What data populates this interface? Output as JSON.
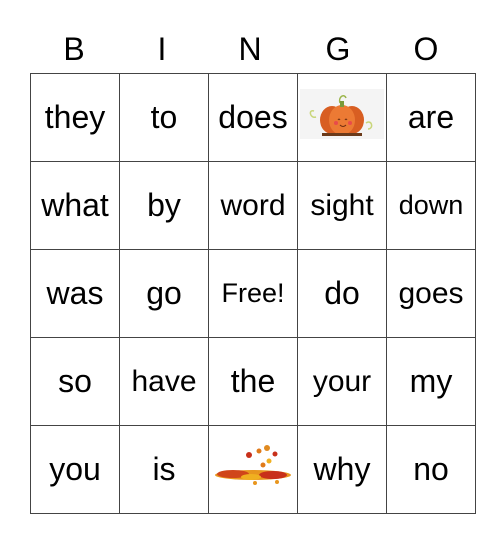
{
  "header": [
    "B",
    "I",
    "N",
    "G",
    "O"
  ],
  "rows": [
    [
      "they",
      "to",
      "does",
      {
        "image": "pumpkin-image"
      },
      "are"
    ],
    [
      "what",
      "by",
      "word",
      "sight",
      "down"
    ],
    [
      "was",
      "go",
      "Free!",
      "do",
      "goes"
    ],
    [
      "so",
      "have",
      "the",
      "your",
      "my"
    ],
    [
      "you",
      "is",
      {
        "image": "autumn-leaves-image"
      },
      "why",
      "no"
    ]
  ],
  "colors": {
    "grid_line": "#444444",
    "pumpkin": "#e06a2a",
    "leaves": "#e8961e"
  }
}
